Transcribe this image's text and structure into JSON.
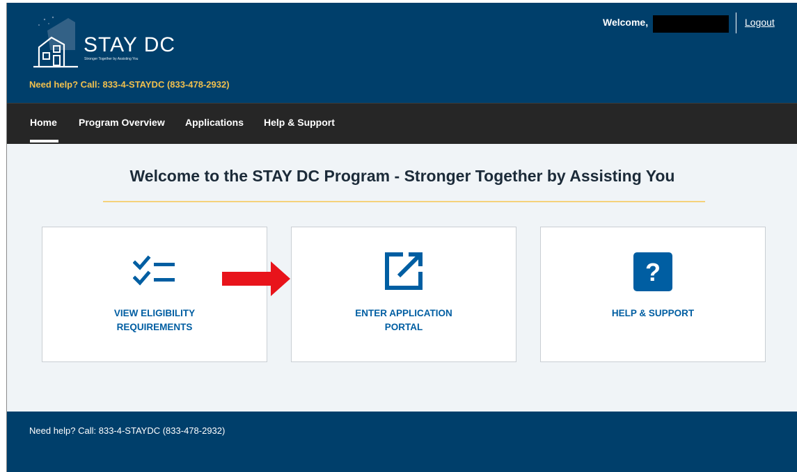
{
  "header": {
    "logo_title": "STAY DC",
    "logo_tagline": "Stronger Together by Assisting You",
    "help_text": "Need help? Call: 833-4-STAYDC (833-478-2932)",
    "welcome": "Welcome,",
    "logout": "Logout"
  },
  "nav": {
    "items": [
      {
        "label": "Home",
        "active": true
      },
      {
        "label": "Program Overview"
      },
      {
        "label": "Applications"
      },
      {
        "label": "Help & Support"
      }
    ]
  },
  "main": {
    "title": "Welcome to the STAY DC Program - Stronger Together by Assisting You",
    "cards": [
      {
        "label": "VIEW ELIGIBILITY REQUIREMENTS",
        "icon": "checklist-icon"
      },
      {
        "label": "ENTER APPLICATION PORTAL",
        "icon": "external-link-icon"
      },
      {
        "label": "HELP & SUPPORT",
        "icon": "question-icon"
      }
    ]
  },
  "footer": {
    "help_text": "Need help? Call: 833-4-STAYDC (833-478-2932)"
  },
  "colors": {
    "brand_navy": "#003f6b",
    "nav_bg": "#262626",
    "accent_gold": "#f2c04d",
    "link_blue": "#005ea2",
    "annotation_red": "#e8141b"
  }
}
